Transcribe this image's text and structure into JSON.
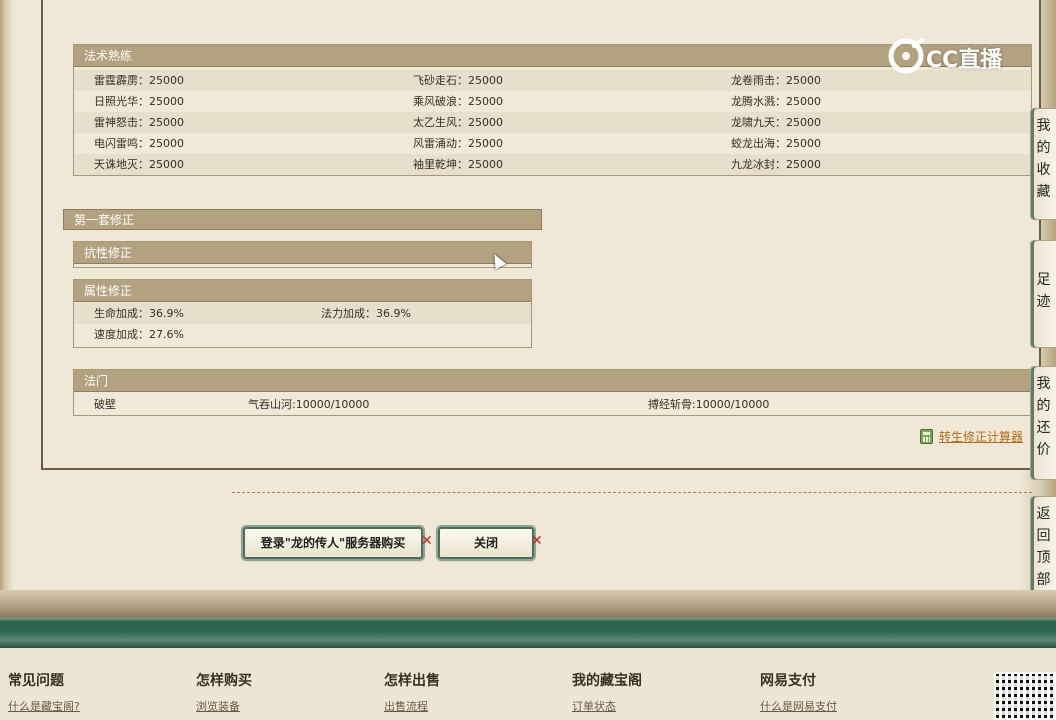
{
  "skill_mastery": {
    "title": "法术熟练",
    "rows": [
      [
        {
          "text": "雷霆霹雳：25000"
        },
        {
          "text": "飞砂走石：25000"
        },
        {
          "text": "龙卷雨击：25000"
        }
      ],
      [
        {
          "text": "日照光华：25000"
        },
        {
          "text": "乘风破浪：25000"
        },
        {
          "text": "龙腾水溅：25000"
        }
      ],
      [
        {
          "text": "雷神怒击：25000"
        },
        {
          "text": "太乙生风：25000"
        },
        {
          "text": "龙啸九天：25000"
        }
      ],
      [
        {
          "text": "电闪雷鸣：25000"
        },
        {
          "text": "风雷涌动：25000"
        },
        {
          "text": "蛟龙出海：25000"
        }
      ],
      [
        {
          "text": "天诛地灭：25000"
        },
        {
          "text": "袖里乾坤：25000"
        },
        {
          "text": "九龙冰封：25000"
        }
      ]
    ]
  },
  "correction_set": {
    "title": "第一套修正",
    "resistance": {
      "title": "抗性修正"
    },
    "attribute": {
      "title": "属性修正",
      "rows": [
        [
          "生命加成：36.9%",
          "法力加成：36.9%"
        ],
        [
          "速度加成：27.6%",
          ""
        ]
      ]
    }
  },
  "fa_men": {
    "title": "法门",
    "row": [
      "破壁",
      "气吞山河:10000/10000",
      "搏经斩骨:10000/10000"
    ]
  },
  "calc_link": "转生修正计算器",
  "buttons": {
    "login_label": "登录\"龙的传人\"服务器购买",
    "close_label": "关闭"
  },
  "sidebar": {
    "items": [
      {
        "label": [
          "我",
          "的",
          "收",
          "藏"
        ]
      },
      {
        "label": [
          "足",
          "迹"
        ]
      },
      {
        "label": [
          "我",
          "的",
          "还",
          "价"
        ]
      },
      {
        "label": [
          "返",
          "回",
          "顶",
          "部"
        ]
      }
    ]
  },
  "watermark": {
    "text": "CC直播"
  },
  "footer": {
    "columns": [
      {
        "title": "常见问题",
        "link": "什么是藏宝阁?"
      },
      {
        "title": "怎样购买",
        "link": "浏览装备"
      },
      {
        "title": "怎样出售",
        "link": "出售流程"
      },
      {
        "title": "我的藏宝阁",
        "link": "订单状态"
      },
      {
        "title": "网易支付",
        "link": "什么是网易支付"
      }
    ]
  }
}
